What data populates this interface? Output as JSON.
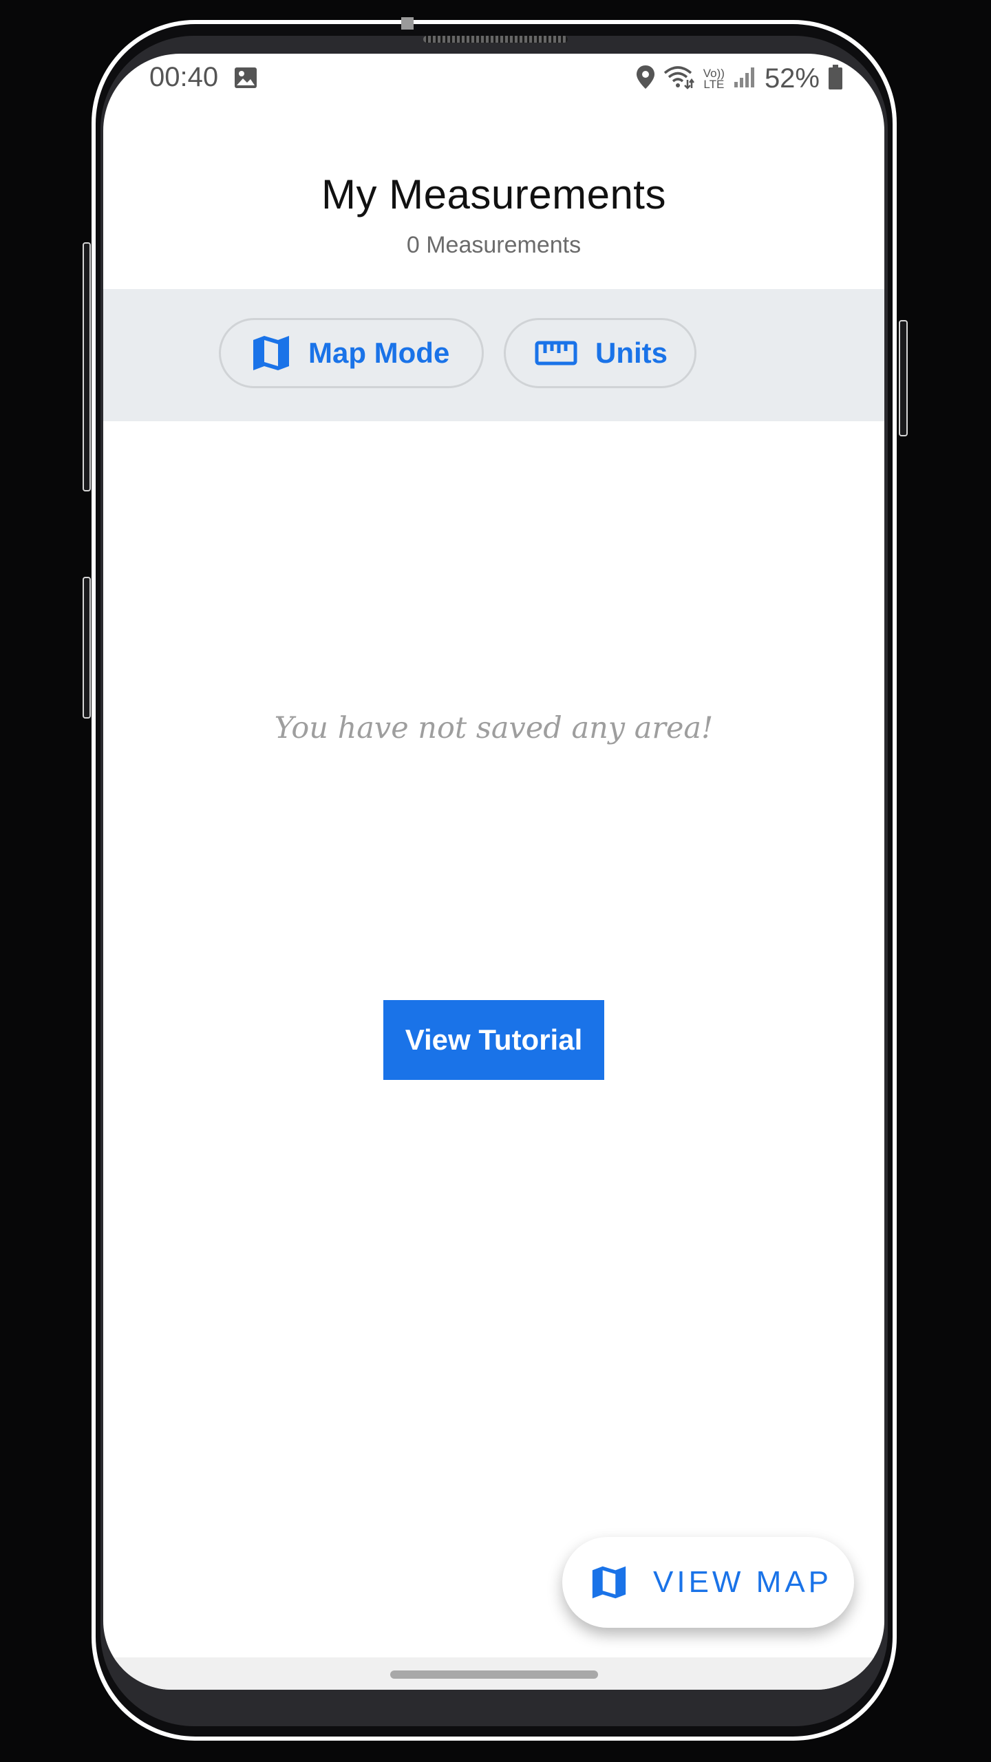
{
  "status_bar": {
    "time": "00:40",
    "battery_percent": "52%",
    "icons": [
      "image-icon",
      "location-icon",
      "wifi-icon",
      "volte-icon",
      "signal-icon",
      "battery-icon"
    ],
    "volte_label_top": "Vo))",
    "volte_label_bottom": "LTE"
  },
  "header": {
    "title": "My Measurements",
    "subtitle": "0 Measurements"
  },
  "toolbar": {
    "map_mode_label": "Map Mode",
    "map_mode_icon": "map-icon",
    "units_label": "Units",
    "units_icon": "ruler-icon"
  },
  "empty_state": {
    "message": "You have not saved any area!"
  },
  "tutorial_button": {
    "label": "View Tutorial"
  },
  "fab": {
    "label": "VIEW MAP",
    "icon": "map-icon"
  },
  "colors": {
    "accent": "#1a73e8",
    "toolbar_background": "#e9ecef",
    "empty_text": "#9e9e9e"
  }
}
